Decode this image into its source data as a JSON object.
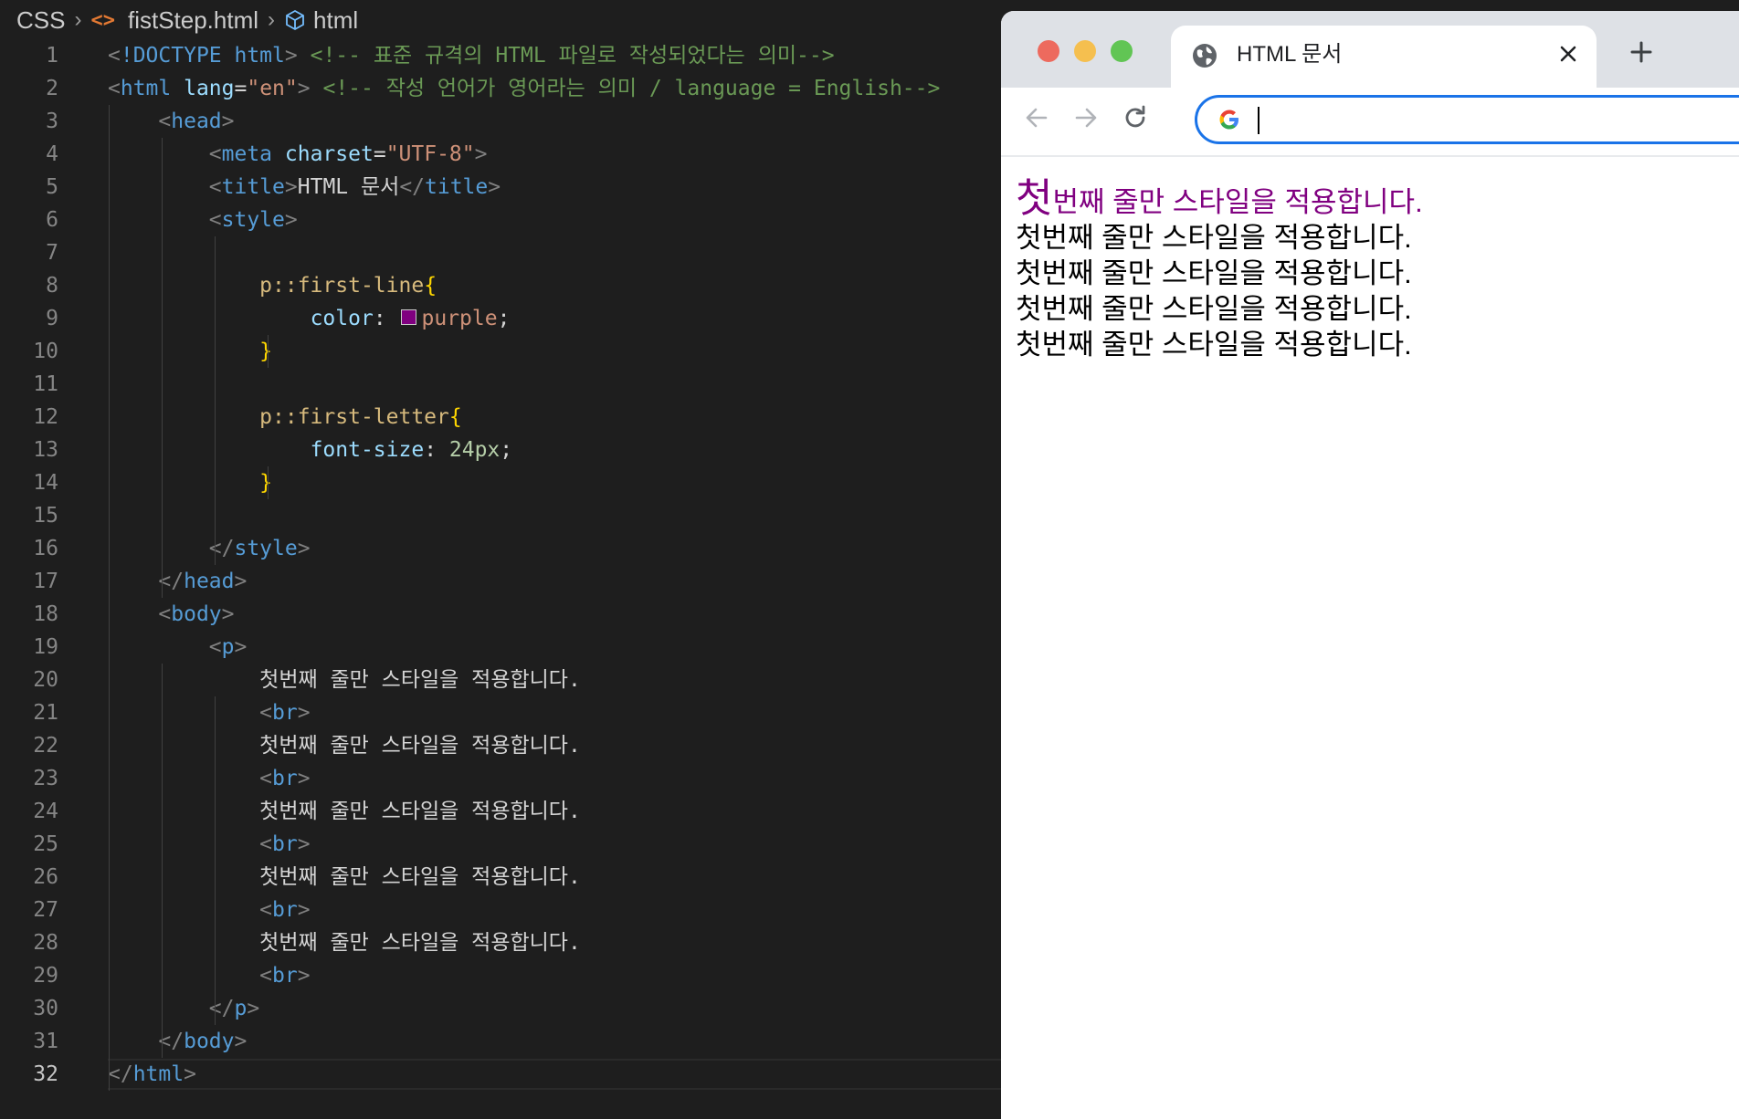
{
  "editor": {
    "breadcrumb": {
      "folder": "CSS",
      "file": "fistStep.html",
      "symbol": "html"
    },
    "line_numbers": [
      "1",
      "2",
      "3",
      "4",
      "5",
      "6",
      "7",
      "8",
      "9",
      "10",
      "11",
      "12",
      "13",
      "14",
      "15",
      "16",
      "17",
      "18",
      "19",
      "20",
      "21",
      "22",
      "23",
      "24",
      "25",
      "26",
      "27",
      "28",
      "29",
      "30",
      "31",
      "32"
    ],
    "code": {
      "l1_doctype": "!DOCTYPE html",
      "l1_comment": "<!-- 표준 규격의 HTML 파일로 작성되었다는 의미-->",
      "l2_tag": "html",
      "l2_attr": "lang",
      "l2_val": "\"en\"",
      "l2_comment": "<!-- 작성 언어가 영어라는 의미 / language = English-->",
      "head": "head",
      "meta": "meta",
      "charset_attr": "charset",
      "charset_val": "\"UTF-8\"",
      "title_tag": "title",
      "title_text": "HTML 문서",
      "style_tag": "style",
      "sel1": "p::first-line",
      "prop1": "color",
      "val1": "purple",
      "sel2": "p::first-letter",
      "prop2": "font-size",
      "val2": "24px",
      "open_brace": "{",
      "close_brace": "}",
      "body": "body",
      "p": "p",
      "br": "br",
      "para_line": "첫번째 줄만 스타일을 적용합니다."
    },
    "colors": {
      "purple_swatch": "#800080"
    }
  },
  "browser": {
    "tab_title": "HTML 문서",
    "address_value": "",
    "icons": [
      "globe-icon",
      "close-icon",
      "plus-icon",
      "back-icon",
      "forward-icon",
      "reload-icon",
      "google-icon"
    ],
    "content": {
      "first_letter": "첫",
      "first_rest": "번째 줄만 스타일을 적용합니다.",
      "lines": [
        "첫번째 줄만 스타일을 적용합니다.",
        "첫번째 줄만 스타일을 적용합니다.",
        "첫번째 줄만 스타일을 적용합니다.",
        "첫번째 줄만 스타일을 적용합니다."
      ]
    },
    "colors": {
      "first_line": "#800080",
      "omnibox_border": "#1a73e8"
    }
  }
}
